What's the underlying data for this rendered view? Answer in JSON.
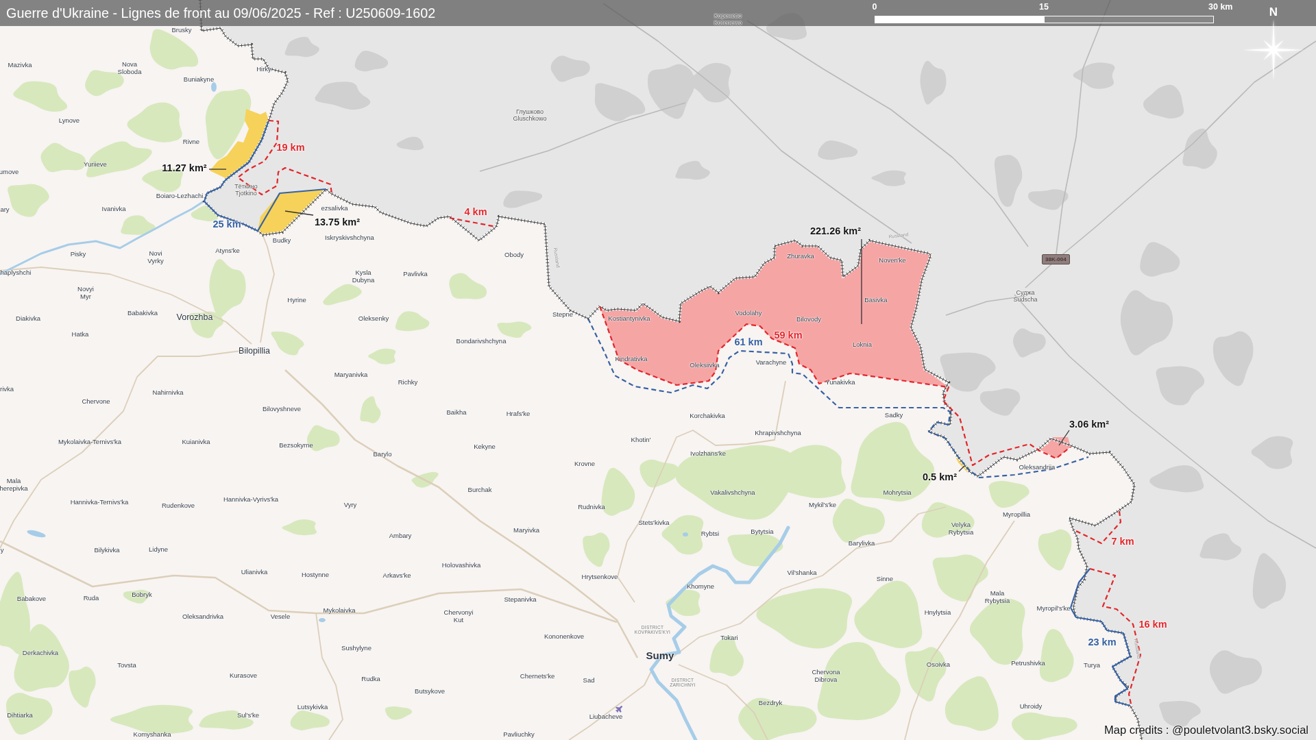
{
  "title": "Guerre d'Ukraine - Lignes de front au 09/06/2025 - Ref : U250609-1602",
  "scale_bar": {
    "ticks": [
      "0",
      "15",
      "30 km"
    ]
  },
  "north_arrow": {
    "label": "N"
  },
  "occupied_areas": [
    {
      "label": "11.27 km²",
      "color": "#f6d25a"
    },
    {
      "label": "13.75 km²",
      "color": "#f6d25a"
    },
    {
      "label": "221.26 km²",
      "color": "#f6a5a5"
    },
    {
      "label": "3.06 km²",
      "color": "#f6a5a5"
    },
    {
      "label": "0.5 km²",
      "color": "#f6d25a"
    }
  ],
  "front_lines": [
    {
      "label": "19 km",
      "color": "#e3262b",
      "kind": "dashed"
    },
    {
      "label": "4 km",
      "color": "#e3262b",
      "kind": "dashed"
    },
    {
      "label": "25 km",
      "color": "#3762a3",
      "kind": "solid"
    },
    {
      "label": "59 km",
      "color": "#e3262b",
      "kind": "dashed"
    },
    {
      "label": "61 km",
      "color": "#3762a3",
      "kind": "dashed"
    },
    {
      "label": "7 km",
      "color": "#e3262b",
      "kind": "dashed"
    },
    {
      "label": "16 km",
      "color": "#e3262b",
      "kind": "dashed"
    },
    {
      "label": "23 km",
      "color": "#3762a3",
      "kind": "solid"
    }
  ],
  "road_shield": {
    "label": "38K-004"
  },
  "places": [
    {
      "name": "Коренево Korenewo",
      "kind": "russian"
    },
    {
      "name": "Brusky",
      "kind": "village"
    },
    {
      "name": "Mazivka",
      "kind": "village"
    },
    {
      "name": "Nova Sloboda",
      "kind": "village"
    },
    {
      "name": "Hirky",
      "kind": "village"
    },
    {
      "name": "Buniakyne",
      "kind": "village"
    },
    {
      "name": "Lynove",
      "kind": "village"
    },
    {
      "name": "Глушково Gluschkowo",
      "kind": "russian"
    },
    {
      "name": "Rivne",
      "kind": "village"
    },
    {
      "name": "Yuriieve",
      "kind": "village"
    },
    {
      "name": "umove",
      "kind": "village"
    },
    {
      "name": "Boiaro-Lezhachi",
      "kind": "village"
    },
    {
      "name": "Тёткино Tjotkino",
      "kind": "russian"
    },
    {
      "name": "ary",
      "kind": "village"
    },
    {
      "name": "Ivanivka",
      "kind": "village"
    },
    {
      "name": "ezsalivka",
      "kind": "village"
    },
    {
      "name": "Budky",
      "kind": "village"
    },
    {
      "name": "Iskryskivshchyna",
      "kind": "village"
    },
    {
      "name": "Russland",
      "kind": "border"
    },
    {
      "name": "Pisky",
      "kind": "village"
    },
    {
      "name": "Novi Vyrky",
      "kind": "village"
    },
    {
      "name": "Atyns'ke",
      "kind": "village"
    },
    {
      "name": "Obody",
      "kind": "village"
    },
    {
      "name": "Russland",
      "kind": "border"
    },
    {
      "name": "Zhuravka",
      "kind": "village"
    },
    {
      "name": "Noven'ke",
      "kind": "village"
    },
    {
      "name": "haplyshchi",
      "kind": "village"
    },
    {
      "name": "Kysla Dubyna",
      "kind": "village"
    },
    {
      "name": "Pavlivka",
      "kind": "village"
    },
    {
      "name": "Novyi Myr",
      "kind": "village"
    },
    {
      "name": "Hyrine",
      "kind": "village"
    },
    {
      "name": "Basivka",
      "kind": "village"
    },
    {
      "name": "Суджа Sudscha",
      "kind": "russian"
    },
    {
      "name": "Diakivka",
      "kind": "village"
    },
    {
      "name": "Babakivka",
      "kind": "village"
    },
    {
      "name": "Vorozhba",
      "kind": "town"
    },
    {
      "name": "Oleksenky",
      "kind": "village"
    },
    {
      "name": "Stepne",
      "kind": "village"
    },
    {
      "name": "Kostiantynivka",
      "kind": "village"
    },
    {
      "name": "Vodolahy",
      "kind": "village"
    },
    {
      "name": "Bilovody",
      "kind": "village"
    },
    {
      "name": "Hatka",
      "kind": "village"
    },
    {
      "name": "Bondarivshchyna",
      "kind": "village"
    },
    {
      "name": "Loknia",
      "kind": "village"
    },
    {
      "name": "Bilopillia",
      "kind": "town"
    },
    {
      "name": "Kindrativka",
      "kind": "village"
    },
    {
      "name": "Oleksiivka",
      "kind": "village"
    },
    {
      "name": "Varachyne",
      "kind": "village"
    },
    {
      "name": "Maryanivka",
      "kind": "village"
    },
    {
      "name": "Richky",
      "kind": "village"
    },
    {
      "name": "Yunakivka",
      "kind": "village"
    },
    {
      "name": "rivka",
      "kind": "village"
    },
    {
      "name": "Nahirnivka",
      "kind": "village"
    },
    {
      "name": "Chervone",
      "kind": "village"
    },
    {
      "name": "Bilovyshneve",
      "kind": "village"
    },
    {
      "name": "Baikha",
      "kind": "village"
    },
    {
      "name": "Hrafs'ke",
      "kind": "village"
    },
    {
      "name": "Korchakivka",
      "kind": "village"
    },
    {
      "name": "Sadky",
      "kind": "village"
    },
    {
      "name": "Khrapivshchyna",
      "kind": "village"
    },
    {
      "name": "Mykolaivka-Ternivs'ka",
      "kind": "village"
    },
    {
      "name": "Kuianivka",
      "kind": "village"
    },
    {
      "name": "Bezsokyrne",
      "kind": "village"
    },
    {
      "name": "Kekyne",
      "kind": "village"
    },
    {
      "name": "Khotin'",
      "kind": "village"
    },
    {
      "name": "Barylo",
      "kind": "village"
    },
    {
      "name": "Ivolzhans'ke",
      "kind": "village"
    },
    {
      "name": "Krovne",
      "kind": "village"
    },
    {
      "name": "Oleksandriia",
      "kind": "village"
    },
    {
      "name": "Mala herepivka",
      "kind": "village"
    },
    {
      "name": "Burchak",
      "kind": "village"
    },
    {
      "name": "Vakalivshchyna",
      "kind": "village"
    },
    {
      "name": "Mohrytsia",
      "kind": "village"
    },
    {
      "name": "Hannivka-Ternivs'ka",
      "kind": "village"
    },
    {
      "name": "Rudenkove",
      "kind": "village"
    },
    {
      "name": "Hannivka-Vyrivs'ka",
      "kind": "village"
    },
    {
      "name": "Vyry",
      "kind": "village"
    },
    {
      "name": "Rudnivka",
      "kind": "village"
    },
    {
      "name": "Mykil's'ke",
      "kind": "village"
    },
    {
      "name": "Myropillia",
      "kind": "village"
    },
    {
      "name": "Stets'kivka",
      "kind": "village"
    },
    {
      "name": "Ambary",
      "kind": "village"
    },
    {
      "name": "Maryivka",
      "kind": "village"
    },
    {
      "name": "Rybtsi",
      "kind": "village"
    },
    {
      "name": "Bytytsia",
      "kind": "village"
    },
    {
      "name": "Velyka Rybytsia",
      "kind": "village"
    },
    {
      "name": "Barylivka",
      "kind": "village"
    },
    {
      "name": "y",
      "kind": "village"
    },
    {
      "name": "Bilykivka",
      "kind": "village"
    },
    {
      "name": "Lidyne",
      "kind": "village"
    },
    {
      "name": "Holovashivka",
      "kind": "village"
    },
    {
      "name": "Ulianivka",
      "kind": "village"
    },
    {
      "name": "Hostynne",
      "kind": "village"
    },
    {
      "name": "Arkavs'ke",
      "kind": "village"
    },
    {
      "name": "Hrytsenkove",
      "kind": "village"
    },
    {
      "name": "Vil'shanka",
      "kind": "village"
    },
    {
      "name": "Sinne",
      "kind": "village"
    },
    {
      "name": "Khomyne",
      "kind": "village"
    },
    {
      "name": "Babakove",
      "kind": "village"
    },
    {
      "name": "Ruda",
      "kind": "village"
    },
    {
      "name": "Bobryk",
      "kind": "village"
    },
    {
      "name": "Stepanivka",
      "kind": "village"
    },
    {
      "name": "Mala Rybytsia",
      "kind": "village"
    },
    {
      "name": "Oleksandrivka",
      "kind": "village"
    },
    {
      "name": "Vesele",
      "kind": "village"
    },
    {
      "name": "Mykolaivka",
      "kind": "village"
    },
    {
      "name": "Chervonyi Kut",
      "kind": "village"
    },
    {
      "name": "Hnylytsia",
      "kind": "village"
    },
    {
      "name": "Myropil's'ke",
      "kind": "village"
    },
    {
      "name": "Kononenkove",
      "kind": "village"
    },
    {
      "name": "DISTRICT KOVPAKIVS'KYI",
      "kind": "district"
    },
    {
      "name": "Tokari",
      "kind": "village"
    },
    {
      "name": "Derkachivka",
      "kind": "village"
    },
    {
      "name": "Sushylyne",
      "kind": "village"
    },
    {
      "name": "Sumy",
      "kind": "city"
    },
    {
      "name": "Russland",
      "kind": "border"
    },
    {
      "name": "Tovsta",
      "kind": "village"
    },
    {
      "name": "Osoivka",
      "kind": "village"
    },
    {
      "name": "Petrushivka",
      "kind": "village"
    },
    {
      "name": "Turya",
      "kind": "village"
    },
    {
      "name": "Kurasove",
      "kind": "village"
    },
    {
      "name": "Rudka",
      "kind": "village"
    },
    {
      "name": "Chernets'ke",
      "kind": "village"
    },
    {
      "name": "Sad",
      "kind": "village"
    },
    {
      "name": "DISTRICT ZARICHNYI",
      "kind": "district"
    },
    {
      "name": "Chervona Dibrova",
      "kind": "village"
    },
    {
      "name": "Butsykove",
      "kind": "village"
    },
    {
      "name": "Lutsykivka",
      "kind": "village"
    },
    {
      "name": "Bezdryk",
      "kind": "village"
    },
    {
      "name": "Uhroidy",
      "kind": "village"
    },
    {
      "name": "Dihtiarka",
      "kind": "village"
    },
    {
      "name": "Sul's'ke",
      "kind": "village"
    },
    {
      "name": "Liubacheve",
      "kind": "village"
    },
    {
      "name": "Komyshanka",
      "kind": "village"
    },
    {
      "name": "Pavliuchky",
      "kind": "village"
    }
  ],
  "credits": "Map credits : @pouletvolant3.bsky.social"
}
